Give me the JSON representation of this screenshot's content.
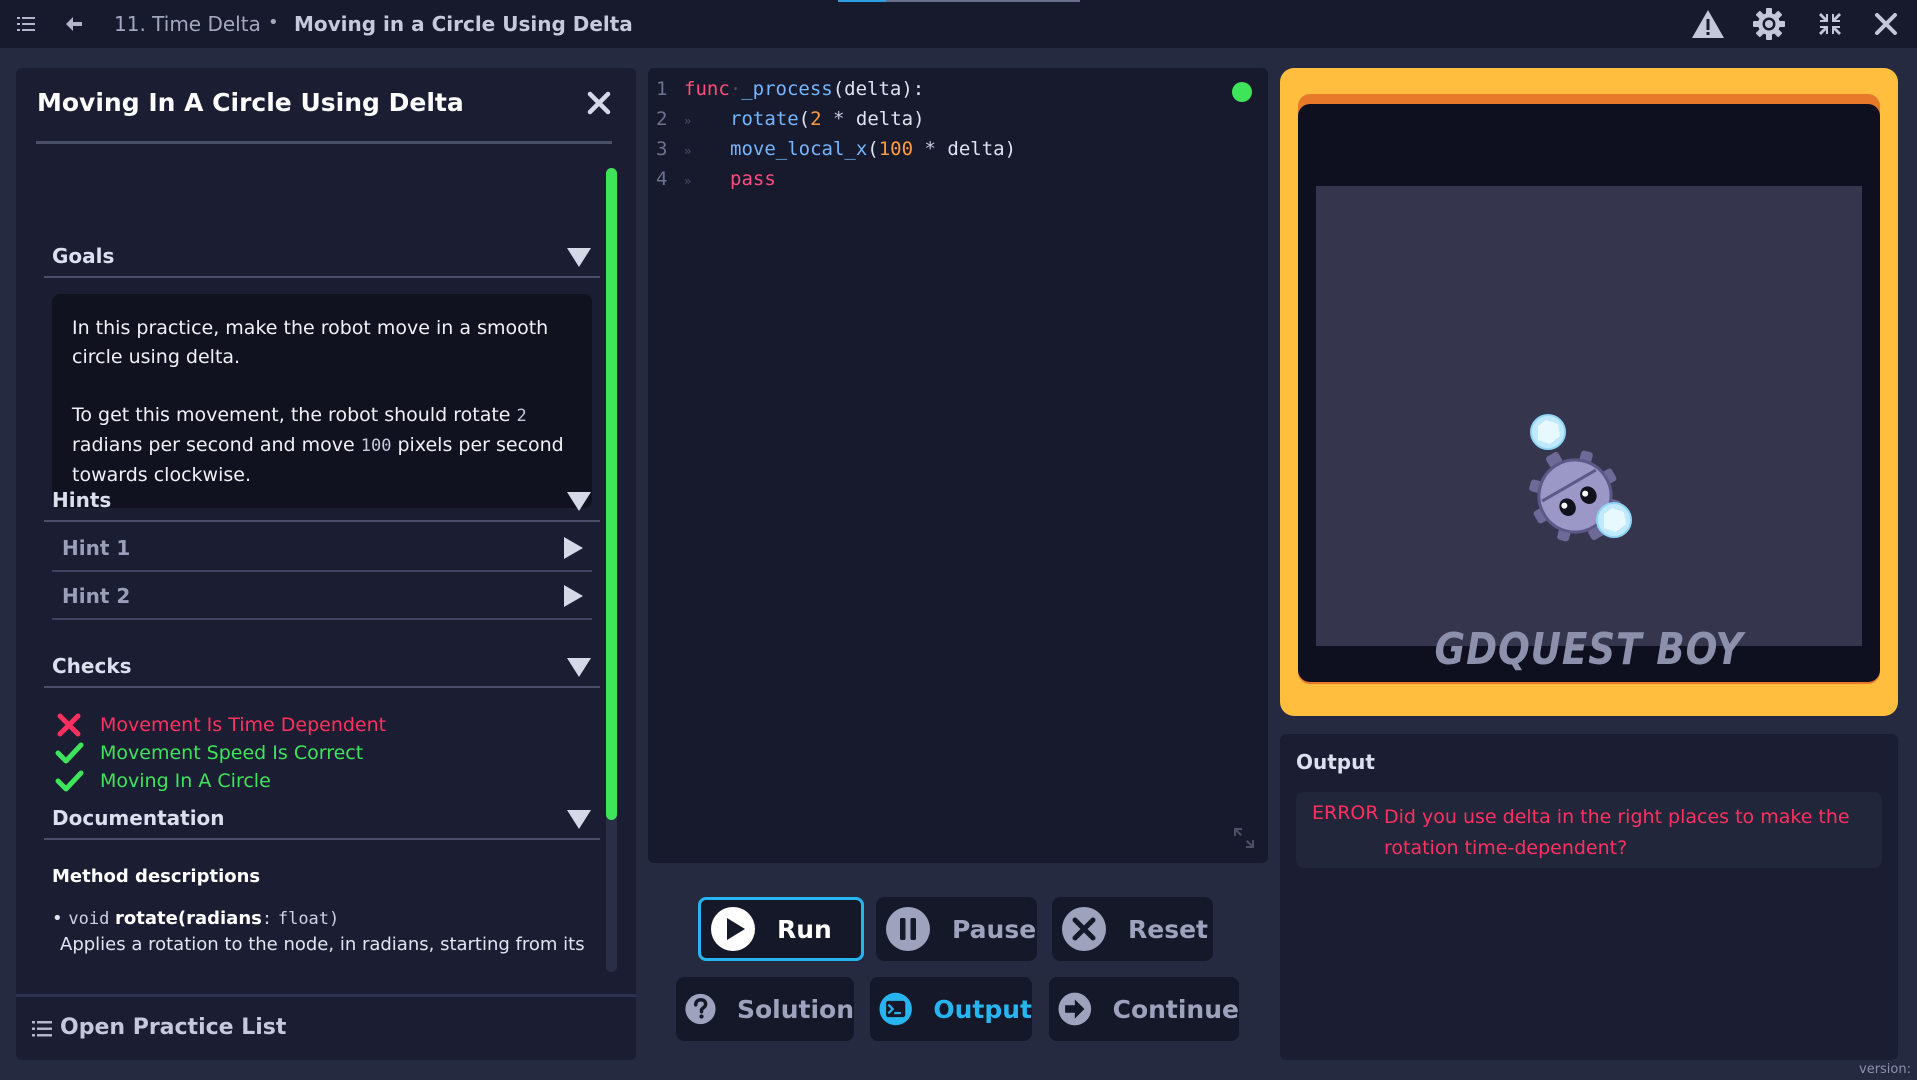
{
  "topbar": {
    "breadcrumb_parent": "11. Time Delta",
    "breadcrumb_separator": "•",
    "breadcrumb_current": "Moving in a Circle Using Delta"
  },
  "left_panel": {
    "title": "Moving In A Circle Using Delta",
    "goals": {
      "label": "Goals",
      "paragraph1": "In this practice, make the robot move in a smooth circle using delta.",
      "p2_part1": "To get this movement, the robot should rotate ",
      "p2_code1": "2",
      "p2_part2": " radians per second and move ",
      "p2_code2": "100",
      "p2_part3": " pixels per second towards clockwise."
    },
    "hints": {
      "label": "Hints",
      "items": [
        {
          "label": "Hint 1"
        },
        {
          "label": "Hint 2"
        }
      ]
    },
    "checks": {
      "label": "Checks",
      "items": [
        {
          "label": "Movement Is Time Dependent",
          "status": "failed",
          "icon": "cross-icon",
          "color": "#ff3060"
        },
        {
          "label": "Movement Speed Is Correct",
          "status": "passed",
          "icon": "checkmark-icon",
          "color": "#3ee45a"
        },
        {
          "label": "Moving In A Circle",
          "status": "passed",
          "icon": "checkmark-icon",
          "color": "#3ee45a"
        }
      ]
    },
    "documentation": {
      "label": "Documentation",
      "subheading": "Method descriptions",
      "method": {
        "bullet": "•",
        "return_type": "void",
        "name": "rotate",
        "open_paren": "(",
        "param_name": "radians",
        "param_sep": ":",
        "param_type": "float",
        "close_paren": ")"
      },
      "description": "Applies a rotation to the node, in radians, starting from its"
    },
    "footer_label": "Open Practice List"
  },
  "editor": {
    "lines": [
      {
        "num": "1",
        "t1": "func",
        "t2": "·",
        "t3": "_process",
        "t4": "(delta):"
      },
      {
        "num": "2",
        "t1": "rotate",
        "t2": "(",
        "t3": "2",
        "t4": " * ",
        "t5": "delta)"
      },
      {
        "num": "3",
        "t1": "move_local_x",
        "t2": "(",
        "t3": "100",
        "t4": " * ",
        "t5": "delta)"
      },
      {
        "num": "4",
        "t1": "pass"
      }
    ],
    "tab_marker": "»"
  },
  "buttons": {
    "run": "Run",
    "pause": "Pause",
    "reset": "Reset",
    "solution": "Solution",
    "output": "Output",
    "continue": "Continue"
  },
  "game": {
    "brand": "GDQUEST BOY"
  },
  "output": {
    "title": "Output",
    "level": "ERROR",
    "message": "Did you use delta in the right places to make the rotation time-dependent?"
  },
  "version_label": "version:",
  "colors": {
    "accent_blue": "#26b5f0",
    "success_green": "#3ee45a",
    "error_red": "#ff3060",
    "frame_yellow": "#ffbe3d"
  }
}
